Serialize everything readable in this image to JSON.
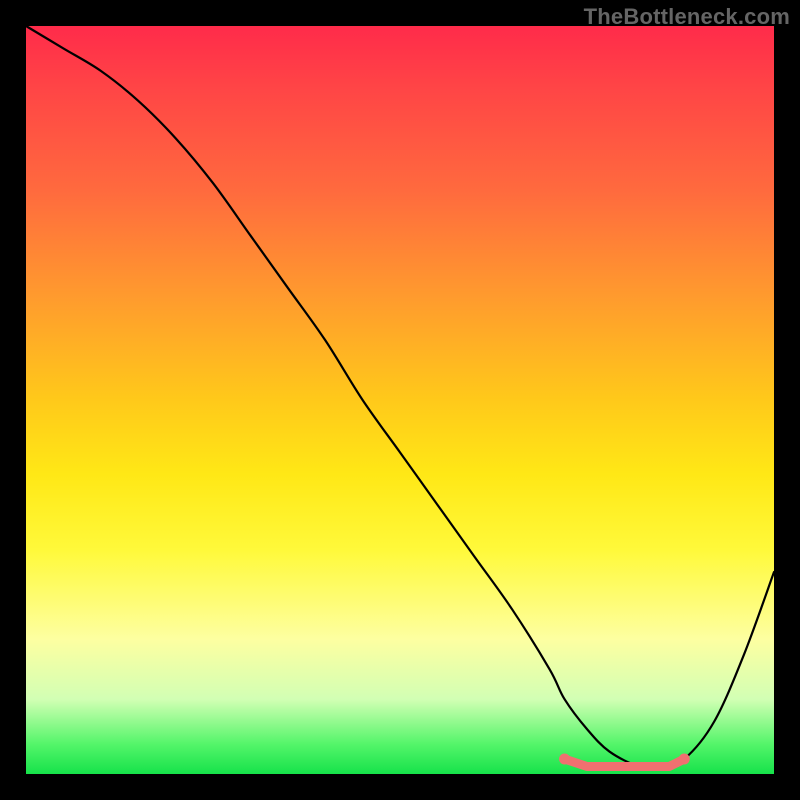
{
  "watermark": "TheBottleneck.com",
  "colors": {
    "frame": "#000000",
    "curve": "#000000",
    "marker": "#f07070",
    "gradient_top": "#ff2b4a",
    "gradient_bottom": "#16e24a"
  },
  "chart_data": {
    "type": "line",
    "title": "",
    "xlabel": "",
    "ylabel": "",
    "xlim": [
      0,
      100
    ],
    "ylim": [
      0,
      100
    ],
    "series": [
      {
        "name": "curve",
        "x": [
          0,
          5,
          10,
          15,
          20,
          25,
          30,
          35,
          40,
          45,
          50,
          55,
          60,
          65,
          70,
          72,
          75,
          78,
          82,
          85,
          88,
          92,
          96,
          100
        ],
        "values": [
          100,
          97,
          94,
          90,
          85,
          79,
          72,
          65,
          58,
          50,
          43,
          36,
          29,
          22,
          14,
          10,
          6,
          3,
          1,
          1,
          2,
          7,
          16,
          27
        ]
      },
      {
        "name": "markers",
        "x": [
          72,
          75,
          78,
          80,
          82,
          84,
          86,
          88
        ],
        "values": [
          2,
          1,
          1,
          1,
          1,
          1,
          1,
          2
        ]
      }
    ]
  }
}
